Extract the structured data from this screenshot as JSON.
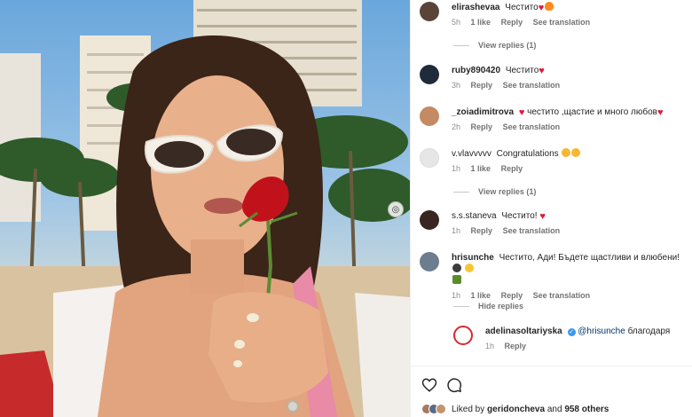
{
  "post": {
    "carousel_icon": "carousel-icon"
  },
  "comments": [
    {
      "user": "elirashevaa",
      "text": "Честито",
      "emojis": [
        "heart",
        "fire"
      ],
      "time": "5h",
      "likes": "1 like",
      "reply": "Reply",
      "translate": "See translation"
    },
    {
      "user": "ruby890420",
      "text": "Честито",
      "emojis": [
        "heart"
      ],
      "time": "3h",
      "reply": "Reply",
      "translate": "See translation"
    },
    {
      "user": "_zoiadimitrova",
      "text_before": "",
      "text": "честито ,щастие и много любов",
      "emojis": [
        "heart"
      ],
      "time": "2h",
      "reply": "Reply",
      "translate": "See translation"
    },
    {
      "user": "v.vlavvvvv",
      "text": "Congratulations",
      "emojis": [
        "heart-eyes",
        "heart-eyes"
      ],
      "time": "1h",
      "likes": "1 like",
      "reply": "Reply"
    },
    {
      "user": "s.s.staneva",
      "text": "Честито!",
      "emojis": [
        "heart"
      ],
      "time": "1h",
      "reply": "Reply",
      "translate": "See translation"
    },
    {
      "user": "hrisunche",
      "text": "Честито, Ади! Бъдете щастливи и влюбени!",
      "emojis": [
        "champagne",
        "smile",
        "bottle"
      ],
      "time": "1h",
      "likes": "1 like",
      "reply": "Reply",
      "translate": "See translation"
    },
    {
      "user": "adelinasoltariyska",
      "mention": "@hrisunche",
      "text": "благодаря",
      "time": "1h",
      "reply": "Reply"
    }
  ],
  "view_replies": [
    "View replies (1)",
    "View replies (1)"
  ],
  "hide_replies": "Hide replies",
  "actions": {
    "like_icon": "heart-outline-icon",
    "comment_icon": "comment-icon"
  },
  "liked_by": {
    "prefix": "Liked by",
    "user": "geridoncheva",
    "middle": "and",
    "others": "958 others"
  },
  "colors": {
    "heart": "#e3173e",
    "link": "#00376b",
    "muted": "#8e8e8e",
    "verified": "#3897f0"
  }
}
